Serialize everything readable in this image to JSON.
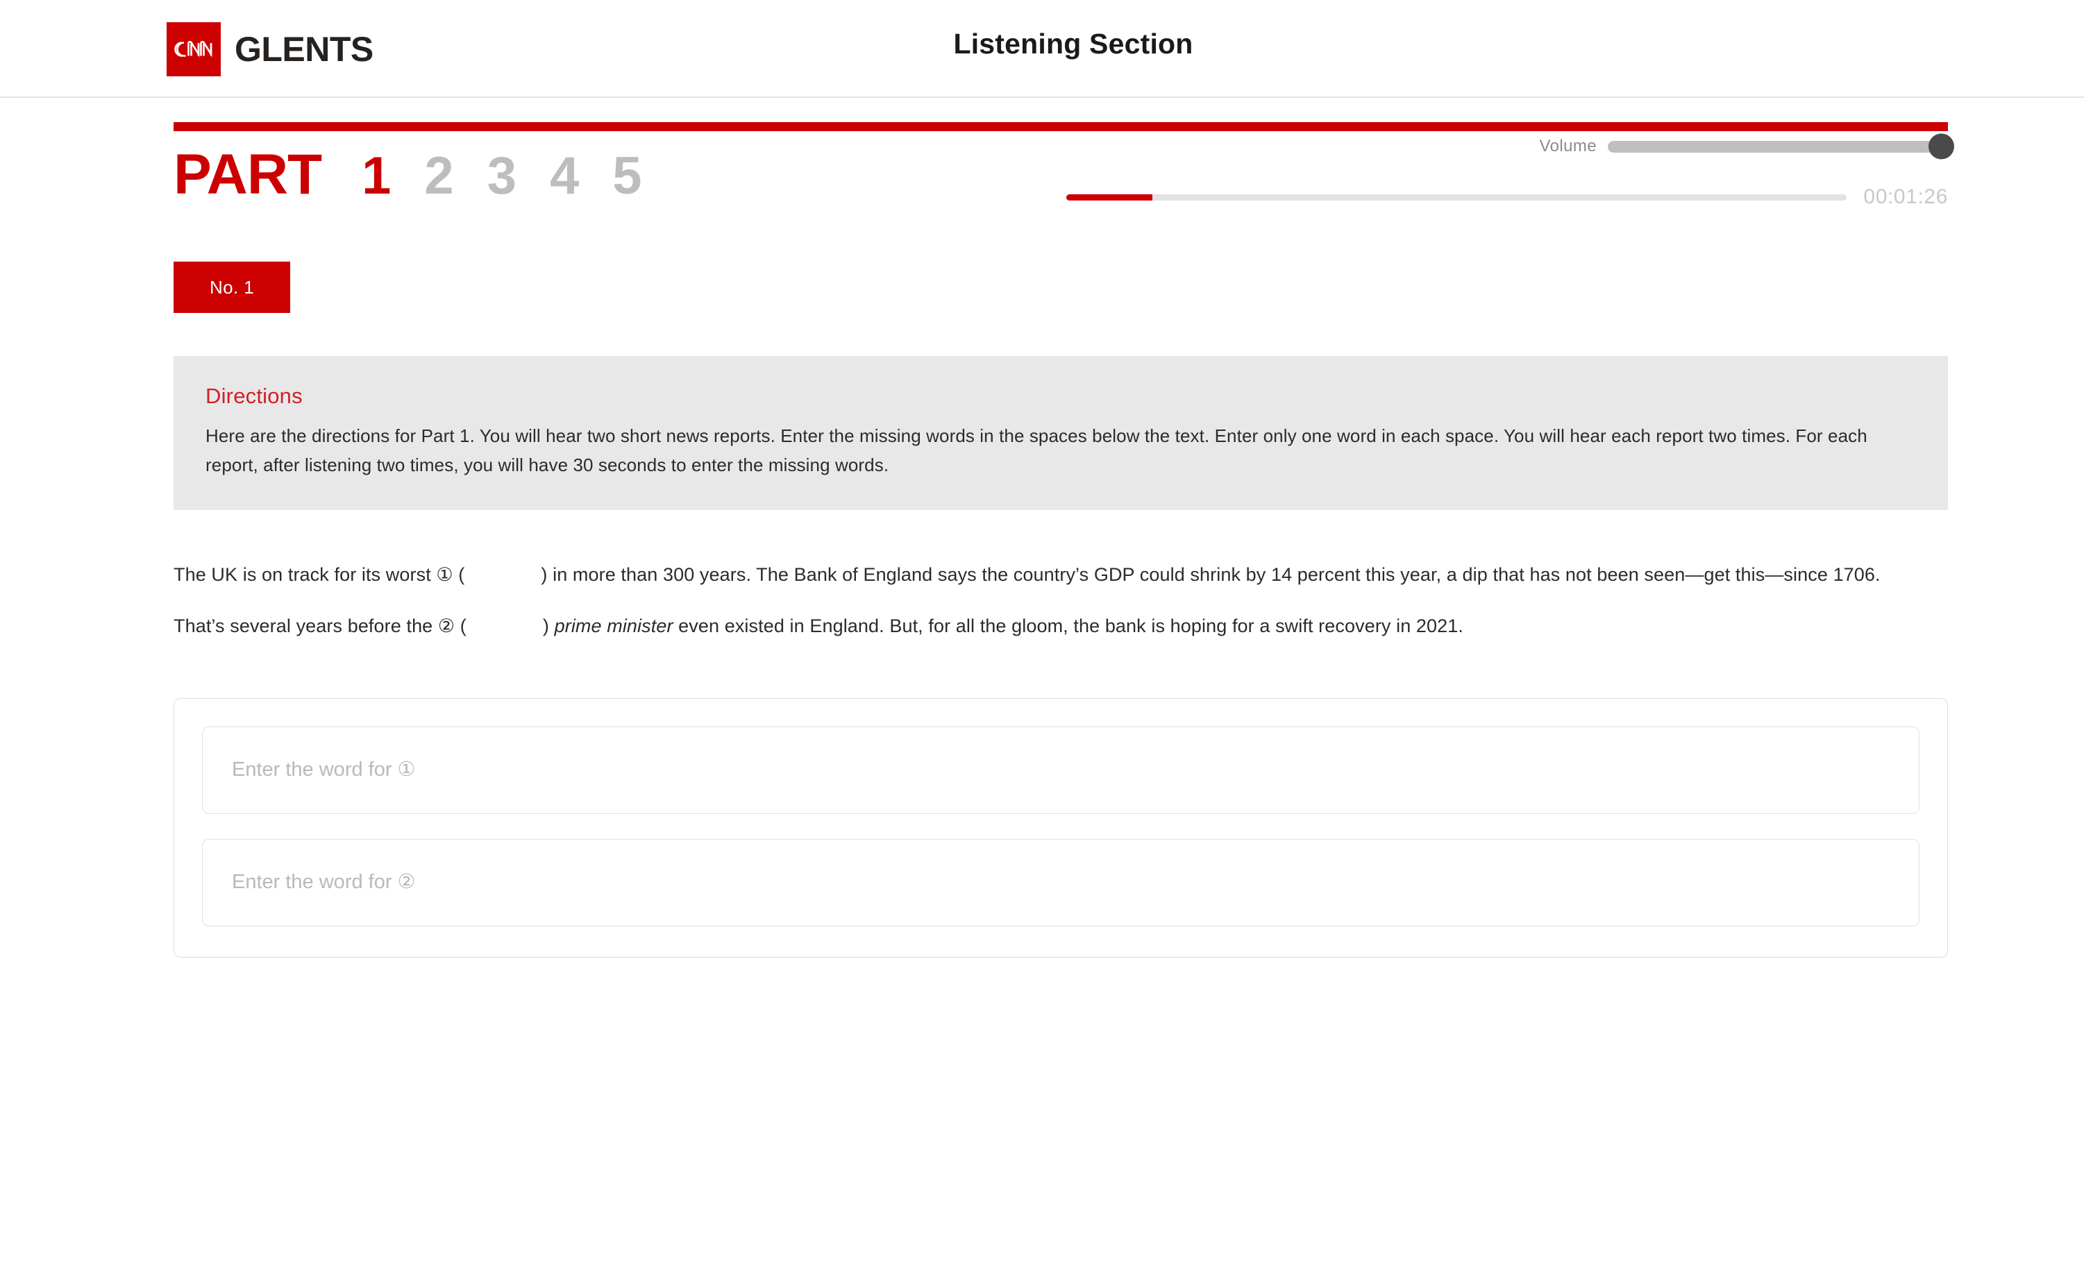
{
  "header": {
    "brand": "GLENTS",
    "logo_icon": "cnn-logo-icon",
    "title": "Listening Section"
  },
  "part_nav": {
    "label": "PART",
    "parts": [
      {
        "number": "1",
        "active": true
      },
      {
        "number": "2",
        "active": false
      },
      {
        "number": "3",
        "active": false
      },
      {
        "number": "4",
        "active": false
      },
      {
        "number": "5",
        "active": false
      }
    ]
  },
  "player": {
    "volume_label": "Volume",
    "volume_percent": 100,
    "progress_percent": 11,
    "time": "00:01:26"
  },
  "question": {
    "badge": "No. 1"
  },
  "directions": {
    "title": "Directions",
    "body": "Here are the directions for Part 1. You will hear two short news reports. Enter the missing words in the spaces below the text. Enter only one word in each space. You will hear each report two times. For each report, after listening two times, you will have 30 seconds to enter the missing words."
  },
  "passage": {
    "seg1": "The UK is on track for its worst ① (",
    "seg2": ") in more than 300 years. The Bank of England says the country’s GDP could shrink by 14 percent this year, a dip that has not been seen—get this—since 1706. That’s several years before the ② (",
    "seg3": ") ",
    "seg4_italic": "prime minister",
    "seg5": " even existed in England. But, for all the gloom, the bank is hoping for a swift recovery in 2021."
  },
  "answers": [
    {
      "placeholder": "Enter the word for ①",
      "value": ""
    },
    {
      "placeholder": "Enter the word for ②",
      "value": ""
    }
  ],
  "colors": {
    "brand_red": "#cc0000",
    "directions_red": "#d12026",
    "inactive_gray": "#bdbdbd"
  }
}
